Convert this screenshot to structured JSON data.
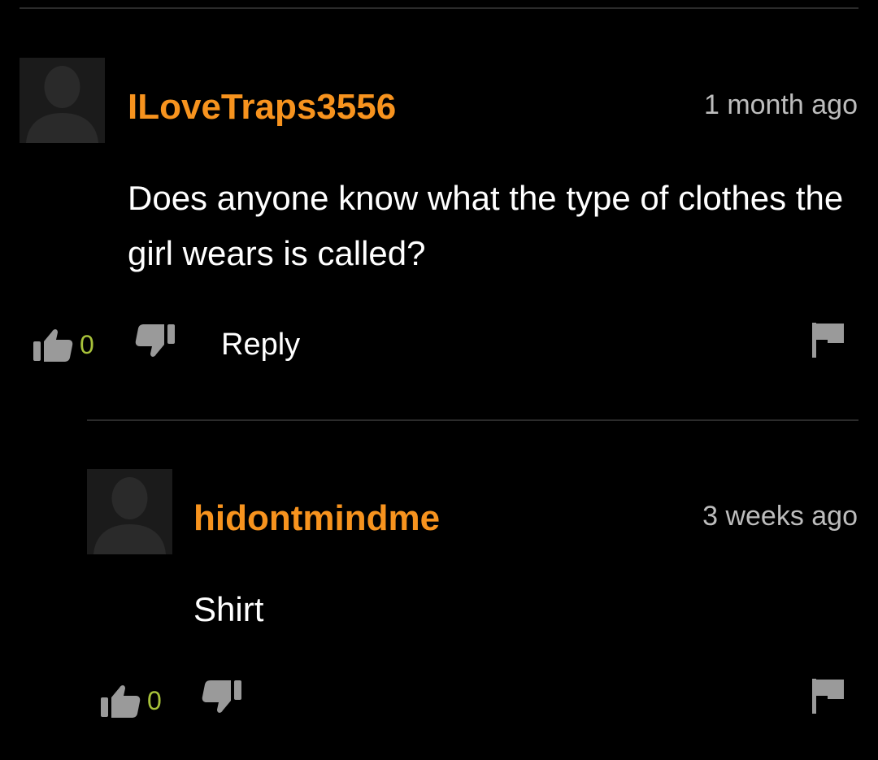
{
  "comments": [
    {
      "username": "ILoveTraps3556",
      "time": "1 month ago",
      "text": "Does anyone know what the type of clothes the girl wears is called?",
      "upvotes": "0",
      "reply_label": "Reply"
    },
    {
      "username": "hidontmindme",
      "time": "3 weeks ago",
      "text": "Shirt",
      "upvotes": "0"
    }
  ],
  "icons": {
    "avatar": "default-avatar-silhouette-icon",
    "upvote": "thumbs-up-icon",
    "downvote": "thumbs-down-icon",
    "flag": "flag-icon"
  },
  "colors": {
    "background": "#000000",
    "username": "#f7931e",
    "vote_count": "#a8c23a",
    "time": "#bdbdbd",
    "icon": "#9a9a9a",
    "divider": "#2b2b2b"
  }
}
